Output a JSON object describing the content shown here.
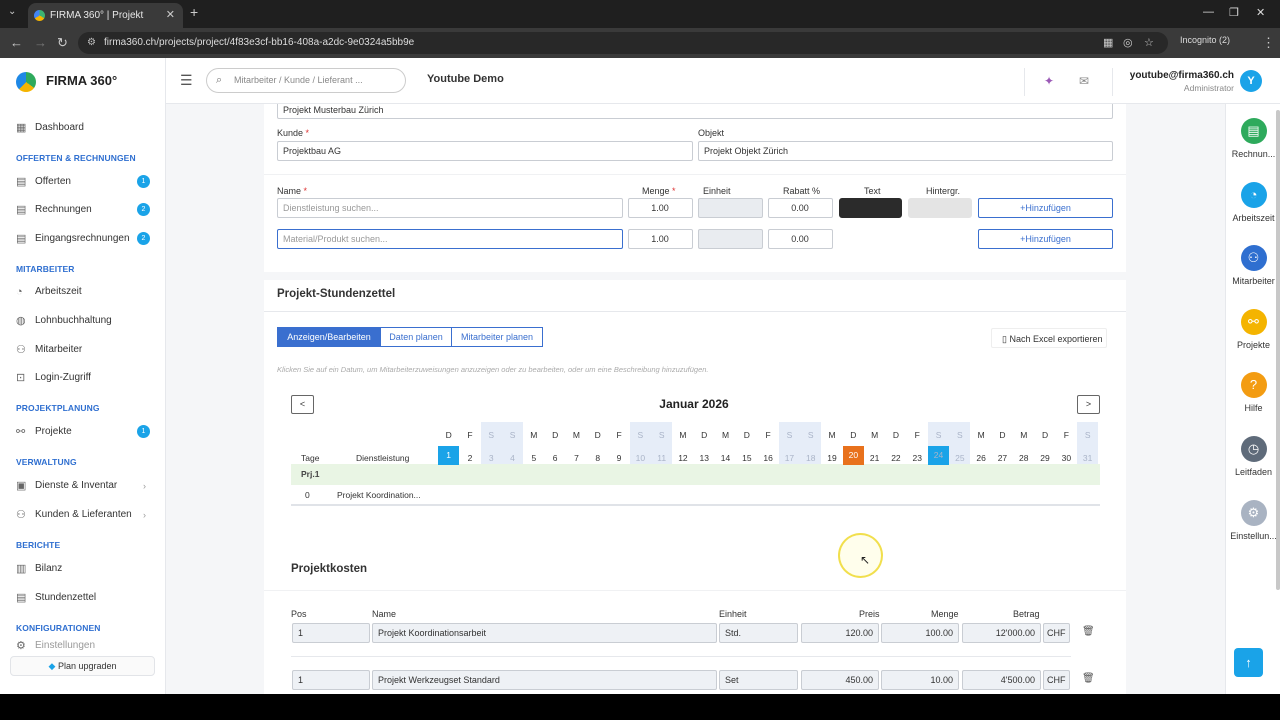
{
  "browser": {
    "tab_title": "FIRMA 360° | Projekt",
    "url": "firma360.ch/projects/project/4f83e3cf-bb16-408a-a2dc-9e0324a5bb9e",
    "incognito": "Incognito (2)"
  },
  "header": {
    "logo": "FIRMA 360°",
    "search_placeholder": "Mitarbeiter / Kunde / Lieferant ...",
    "company": "Youtube Demo",
    "user_email": "youtube@firma360.ch",
    "user_role": "Administrator",
    "avatar_letter": "Y"
  },
  "sidebar": {
    "dashboard": "Dashboard",
    "sec_offerten": "OFFERTEN & RECHNUNGEN",
    "offerten": "Offerten",
    "offerten_badge": "1",
    "rechnungen": "Rechnungen",
    "rechnungen_badge": "2",
    "eingangsrechnungen": "Eingangsrechnungen",
    "eingangsrechnungen_badge": "2",
    "sec_mitarbeiter": "MITARBEITER",
    "arbeitszeit": "Arbeitszeit",
    "lohnbuchhaltung": "Lohnbuchhaltung",
    "mitarbeiter": "Mitarbeiter",
    "login_zugriff": "Login-Zugriff",
    "sec_projektplanung": "PROJEKTPLANUNG",
    "projekte": "Projekte",
    "projekte_badge": "1",
    "sec_verwaltung": "VERWALTUNG",
    "dienste": "Dienste & Inventar",
    "kunden": "Kunden & Lieferanten",
    "sec_berichte": "BERICHTE",
    "bilanz": "Bilanz",
    "stundenzettel": "Stundenzettel",
    "sec_konfig": "KONFIGURATIONEN",
    "einstellungen": "Einstellungen",
    "upgrade": "Plan upgraden"
  },
  "rail": {
    "rechnungen": "Rechnun...",
    "arbeitszeit": "Arbeitszeit",
    "mitarbeiter": "Mitarbeiter",
    "projekte": "Projekte",
    "hilfe": "Hilfe",
    "leitfaden": "Leitfaden",
    "einstellungen": "Einstellun..."
  },
  "form": {
    "project_name": "Projekt Musterbau Zürich",
    "kunde_label": "Kunde",
    "kunde_value": "Projektbau AG",
    "objekt_label": "Objekt",
    "objekt_value": "Projekt Objekt Zürich",
    "name_label": "Name",
    "menge_label": "Menge",
    "einheit_label": "Einheit",
    "rabatt_label": "Rabatt %",
    "text_label": "Text",
    "hintergrund_label": "Hintergr.",
    "service_placeholder": "Dienstleistung suchen...",
    "service_menge": "1.00",
    "service_rabatt": "0.00",
    "material_placeholder": "Material/Produkt suchen...",
    "material_menge": "1.00",
    "material_rabatt": "0.00",
    "add_label": "Hinzufügen",
    "text_color": "#2b2b2b",
    "bg_color": "#e4e4e4"
  },
  "stundenzettel": {
    "title": "Projekt-Stundenzettel",
    "tab_show": "Anzeigen/Bearbeiten",
    "tab_plan": "Daten planen",
    "tab_staff": "Mitarbeiter planen",
    "export": "Nach Excel exportieren",
    "hint": "Klicken Sie auf ein Datum, um Mitarbeiterzuweisungen anzuzeigen oder zu bearbeiten, oder um eine Beschreibung hinzuzufügen.",
    "month": "Januar 2026",
    "prev": "<",
    "next": ">",
    "col_tage": "Tage",
    "col_dienst": "Dienstleistung",
    "weekdays": [
      "D",
      "F",
      "S",
      "S",
      "M",
      "D",
      "M",
      "D",
      "F",
      "S",
      "S",
      "M",
      "D",
      "M",
      "D",
      "F",
      "S",
      "S",
      "M",
      "D",
      "M",
      "D",
      "F",
      "S",
      "S",
      "M",
      "D",
      "M",
      "D",
      "F",
      "S"
    ],
    "days": [
      "1",
      "2",
      "3",
      "4",
      "5",
      "6",
      "7",
      "8",
      "9",
      "10",
      "11",
      "12",
      "13",
      "14",
      "15",
      "16",
      "17",
      "18",
      "19",
      "20",
      "21",
      "22",
      "23",
      "24",
      "25",
      "26",
      "27",
      "28",
      "29",
      "30",
      "31"
    ],
    "group_label": "Prj.1",
    "row_tage": "0",
    "row_dienst": "Projekt Koordination..."
  },
  "kosten": {
    "title": "Projektkosten",
    "headers": {
      "pos": "Pos",
      "name": "Name",
      "einheit": "Einheit",
      "preis": "Preis",
      "menge": "Menge",
      "betrag": "Betrag"
    },
    "rows": [
      {
        "pos": "1",
        "name": "Projekt Koordinationsarbeit",
        "einheit": "Std.",
        "preis": "120.00",
        "menge": "100.00",
        "betrag": "12'000.00",
        "currency": "CHF"
      },
      {
        "pos": "1",
        "name": "Projekt Werkzeugset Standard",
        "einheit": "Set",
        "preis": "450.00",
        "menge": "10.00",
        "betrag": "4'500.00",
        "currency": "CHF"
      }
    ]
  },
  "colors": {
    "accent": "#3a6fcf",
    "today": "#1aa3e8",
    "highlight": "#e8711c",
    "group_row": "#e9f5e4"
  }
}
